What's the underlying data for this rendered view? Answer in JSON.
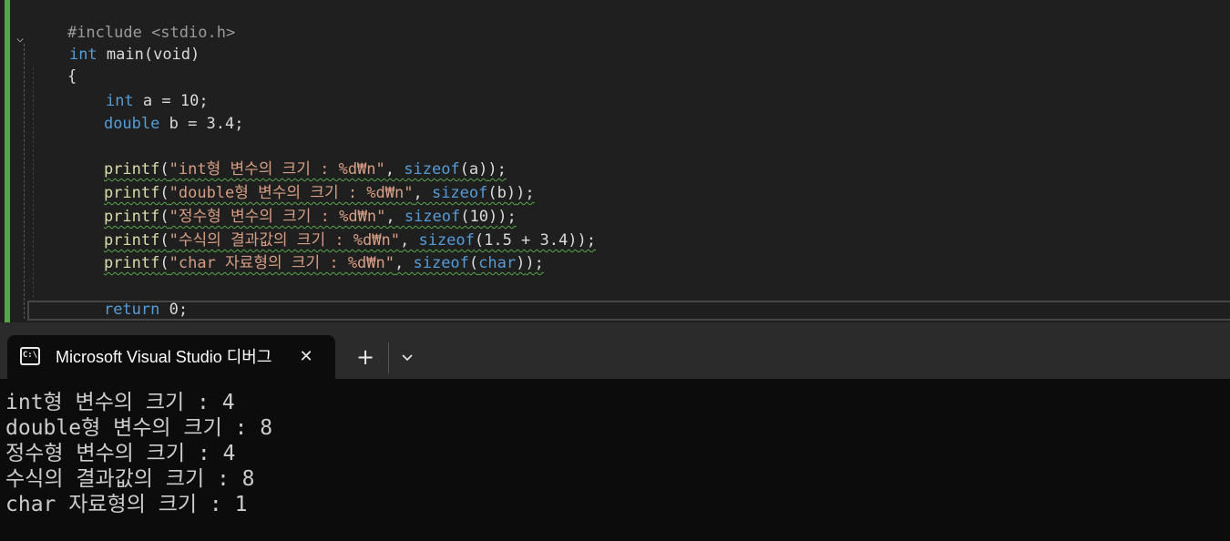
{
  "editor": {
    "lines": {
      "include": "#include <stdio.h>",
      "kw_int": "int",
      "main_sig": " main(void)",
      "open_brace": "{",
      "decl_a_kw": "int",
      "decl_a_rest": " a = 10;",
      "decl_b_kw": "double",
      "decl_b_rest": " b = 3.4;",
      "p1": {
        "fn": "printf",
        "open": "(",
        "str": "\"int형 변수의 크기 : %d₩n\"",
        "comma": ", ",
        "sz": "sizeof",
        "arg": "(a)",
        "end": ");"
      },
      "p2": {
        "fn": "printf",
        "open": "(",
        "str": "\"double형 변수의 크기 : %d₩n\"",
        "comma": ", ",
        "sz": "sizeof",
        "arg": "(b)",
        "end": ");"
      },
      "p3": {
        "fn": "printf",
        "open": "(",
        "str": "\"정수형 변수의 크기 : %d₩n\"",
        "comma": ", ",
        "sz": "sizeof",
        "arg": "(10)",
        "end": ");"
      },
      "p4": {
        "fn": "printf",
        "open": "(",
        "str": "\"수식의 결과값의 크기 : %d₩n\"",
        "comma": ", ",
        "sz": "sizeof",
        "arg": "(1.5 + 3.4)",
        "end": ");"
      },
      "p5": {
        "fn": "printf",
        "open": "(",
        "str": "\"char 자료형의 크기 : %d₩n\"",
        "comma": ", ",
        "sz": "sizeof",
        "arg_open": "(",
        "arg_kw": "char",
        "arg_close": ")",
        "end": ");"
      },
      "ret_kw": "return",
      "ret_rest": " 0;",
      "close_brace": "}"
    },
    "fold_icon": "chevron-down-icon"
  },
  "terminal": {
    "tab_title": "Microsoft Visual Studio 디버그",
    "tab_icon_text": "C:\\",
    "tab_icon": "console-icon",
    "close_glyph": "✕",
    "new_tab_glyph": "+",
    "output": [
      "int형 변수의 크기 : 4",
      "double형 변수의 크기 : 8",
      "정수형 변수의 크기 : 4",
      "수식의 결과값의 크기 : 8",
      "char 자료형의 크기 : 1"
    ]
  },
  "colors": {
    "editor_bg": "#1f1f1f",
    "keyword": "#569cd6",
    "string": "#d69d85",
    "function": "#dcdcaa",
    "change_bar": "#57a64a",
    "terminal_bg": "#0c0c0c"
  }
}
